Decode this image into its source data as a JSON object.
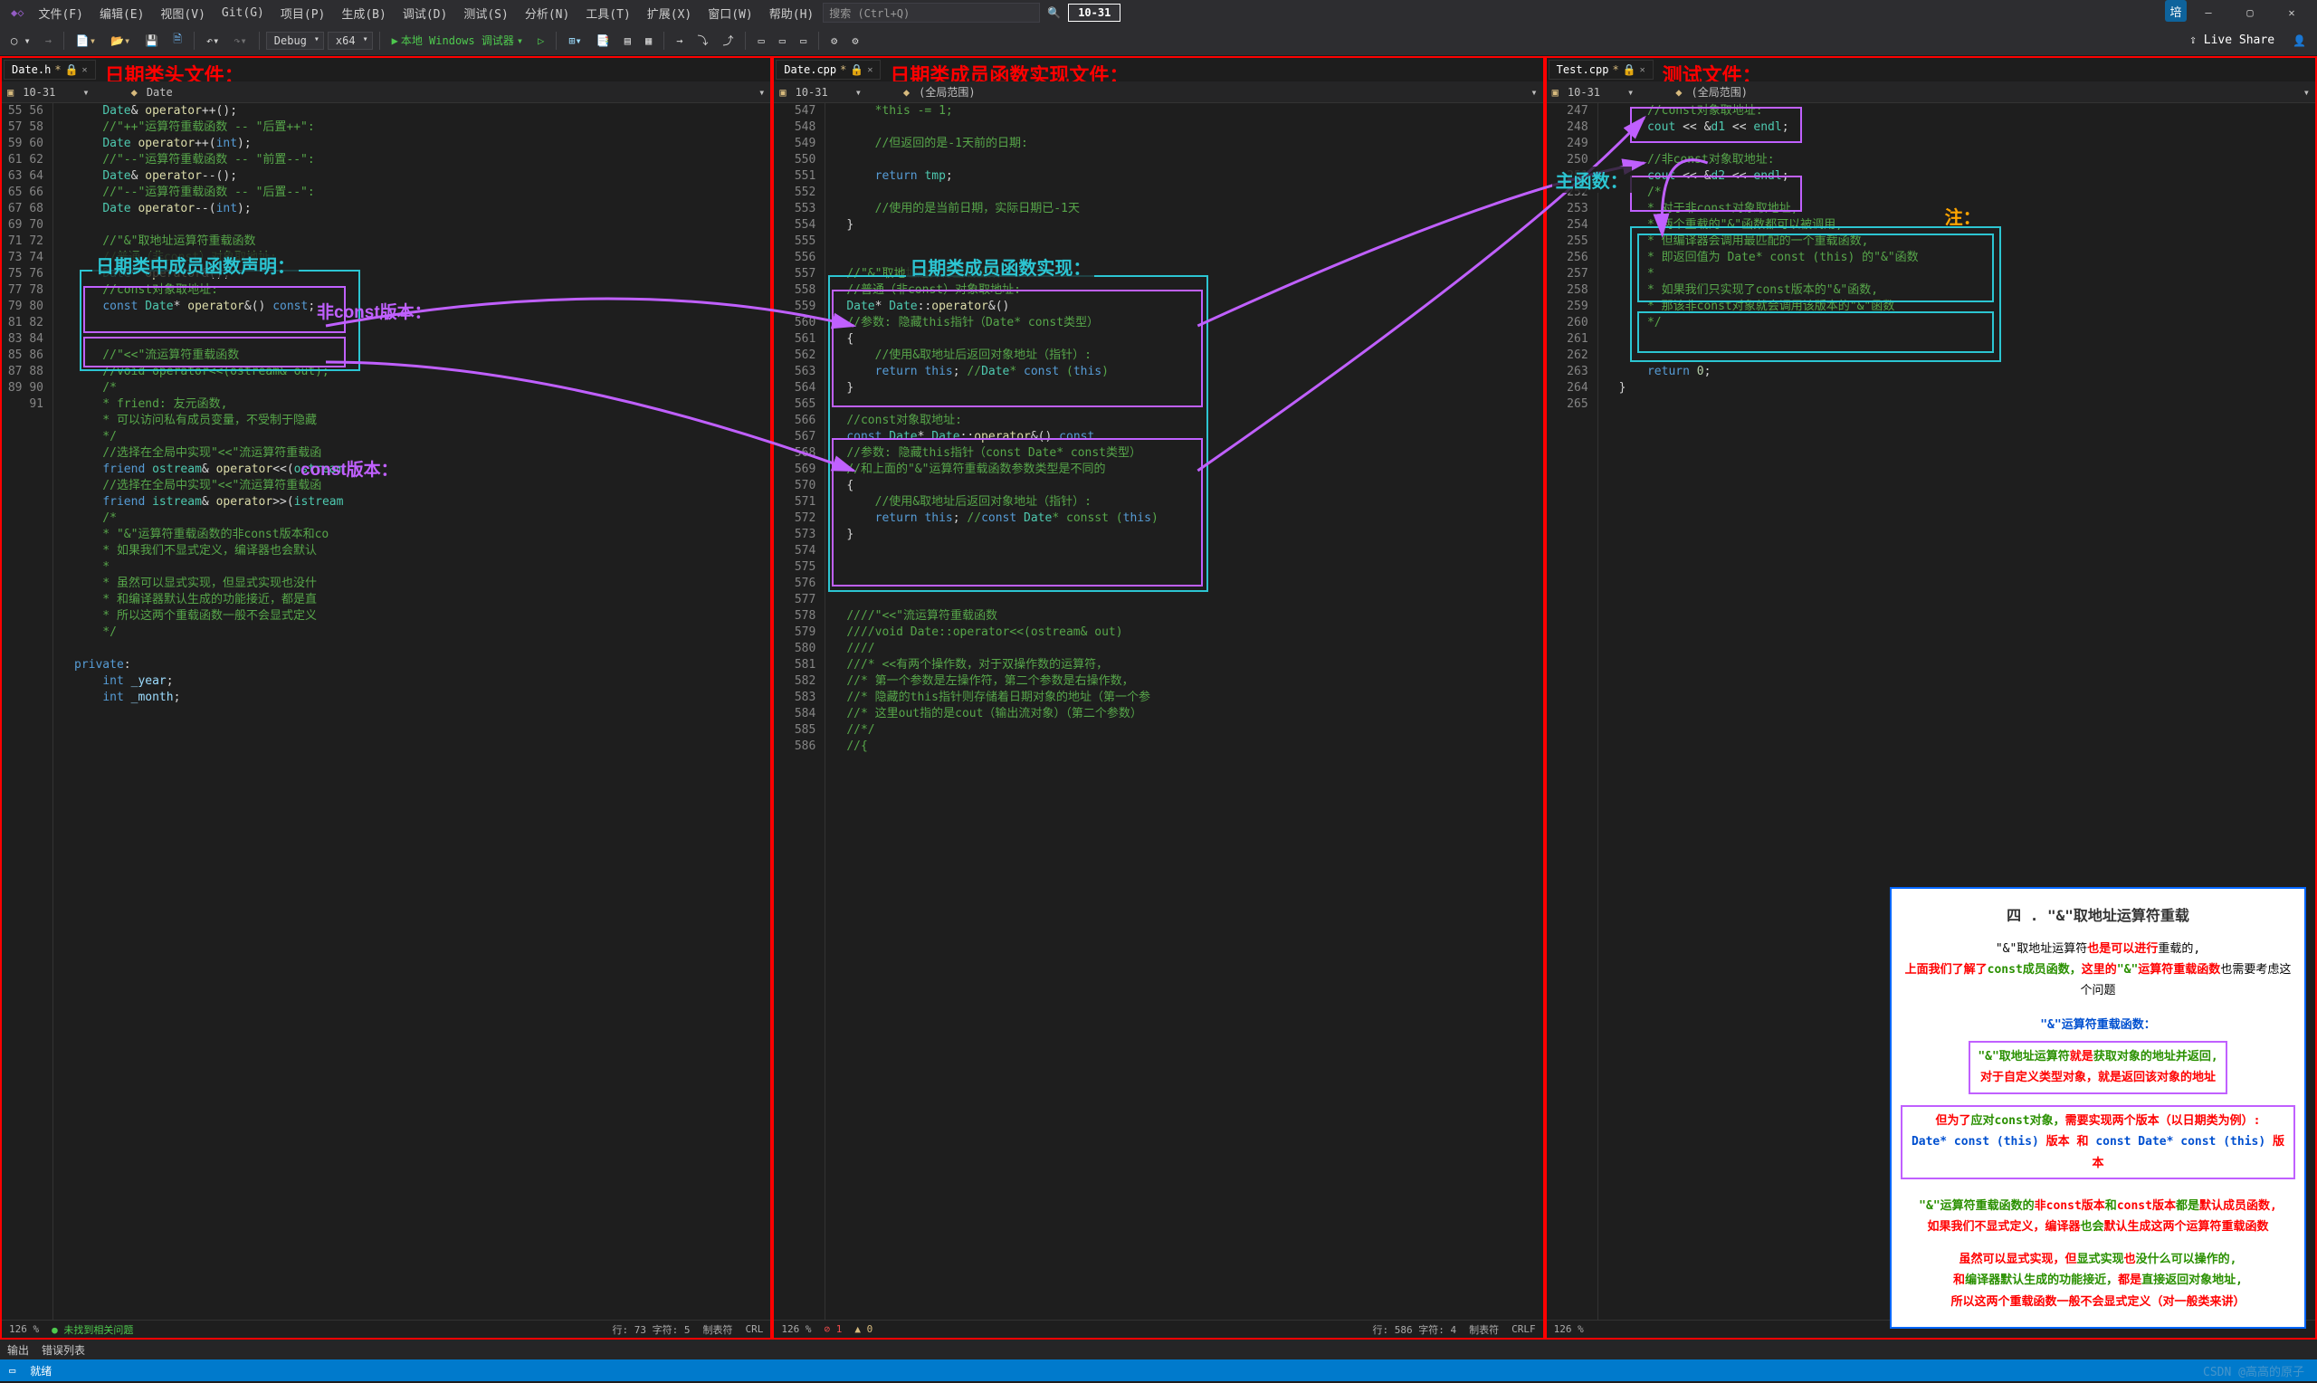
{
  "menu": [
    "文件(F)",
    "编辑(E)",
    "视图(V)",
    "Git(G)",
    "项目(P)",
    "生成(B)",
    "调试(D)",
    "测试(S)",
    "分析(N)",
    "工具(T)",
    "扩展(X)",
    "窗口(W)",
    "帮助(H)"
  ],
  "search_placeholder": "搜索 (Ctrl+Q)",
  "date_badge": "10-31",
  "user_initial": "培",
  "toolbar": {
    "config": "Debug",
    "platform": "x64",
    "debugger": "本地 Windows 调试器",
    "live_share": "Live Share"
  },
  "panes": [
    {
      "tab": "Date.h*",
      "title_label": "日期类头文件：",
      "crumb_left": "10-31",
      "crumb_right": "Date",
      "status": {
        "zoom": "126 %",
        "issues": "未找到相关问题",
        "pos": "行: 73   字符: 5",
        "insert": "制表符",
        "eol": "CRL"
      },
      "first_line": 55,
      "lines": [
        "    Date& operator++();",
        "    //\"++\"运算符重载函数 -- \"后置++\":",
        "    Date operator++(int);",
        "    //\"--\"运算符重载函数 -- \"前置--\":",
        "    Date& operator--();",
        "    //\"--\"运算符重载函数 -- \"后置--\":",
        "    Date operator--(int);",
        "",
        "    //\"&\"取地址运算符重载函数",
        "    //普通（非const）对象取地址:",
        "    Date* operator&();",
        "    //const对象取地址:",
        "    const Date* operator&() const;",
        "",
        "",
        "    //\"<<\"流运算符重载函数",
        "    //void operator<<(ostream& out);",
        "    /*",
        "    * friend: 友元函数,",
        "    * 可以访问私有成员变量，不受制于隐藏",
        "    */",
        "    //选择在全局中实现\"<<\"流运算符重载函",
        "    friend ostream& operator<<(ostream",
        "    //选择在全局中实现\"<<\"流运算符重载函",
        "    friend istream& operator>>(istream",
        "    /*",
        "    * \"&\"运算符重载函数的非const版本和co",
        "    * 如果我们不显式定义，编译器也会默认",
        "    *",
        "    * 虽然可以显式实现，但显式实现也没什",
        "    * 和编译器默认生成的功能接近，都是直",
        "    * 所以这两个重载函数一般不会显式定义",
        "    */",
        "",
        "private:",
        "    int _year;",
        "    int _month;"
      ]
    },
    {
      "tab": "Date.cpp*",
      "title_label": "日期类成员函数实现文件：",
      "crumb_left": "10-31",
      "crumb_right": "(全局范围)",
      "status": {
        "zoom": "126 %",
        "err": "1",
        "warn": "0",
        "pos": "行: 586   字符: 4",
        "insert": "制表符",
        "eol": "CRLF"
      },
      "first_line": 547,
      "lines": [
        "    *this -= 1;",
        "",
        "    //但返回的是-1天前的日期:",
        "",
        "    return tmp;",
        "",
        "    //使用的是当前日期，实际日期已-1天",
        "}",
        "",
        "",
        "//\"&\"取地址运算符重载函数:",
        "//普通（非const）对象取地址:",
        "Date* Date::operator&()",
        "//参数: 隐藏this指针（Date* const类型）",
        "{",
        "    //使用&取地址后返回对象地址（指针）:",
        "    return this; //Date* const (this)",
        "}",
        "",
        "//const对象取地址:",
        "const Date* Date::operator&() const",
        "//参数: 隐藏this指针（const Date* const类型）",
        "//和上面的\"&\"运算符重载函数参数类型是不同的",
        "{",
        "    //使用&取地址后返回对象地址（指针）:",
        "    return this; //const Date* consst (this)",
        "}",
        "",
        "",
        "",
        "",
        "////\"<<\"流运算符重载函数",
        "////void Date::operator<<(ostream& out)",
        "////",
        "///* <<有两个操作数，对于双操作数的运算符，",
        "//* 第一个参数是左操作符，第二个参数是右操作数，",
        "//* 隐藏的this指针则存储着日期对象的地址（第一个参",
        "//* 这里out指的是cout（输出流对象）（第二个参数）",
        "//*/",
        "//{"
      ]
    },
    {
      "tab": "Test.cpp*",
      "title_label": "测试文件：",
      "crumb_left": "10-31",
      "crumb_right": "(全局范围)",
      "status": {
        "zoom": "126 %"
      },
      "first_line": 247,
      "lines": [
        "    //const对象取地址:",
        "    cout << &d1 << endl;",
        "",
        "    //非const对象取地址:",
        "    cout << &d2 << endl;",
        "    /*",
        "    * 对于非const对象取地址,",
        "    * 两个重载的\"&\"函数都可以被调用,",
        "    * 但编译器会调用最匹配的一个重载函数,",
        "    * 即返回值为 Date* const (this) 的\"&\"函数",
        "    *",
        "    * 如果我们只实现了const版本的\"&\"函数,",
        "    * 那该非const对象就会调用该版本的\"&\"函数",
        "    */",
        "",
        "",
        "    return 0;",
        "}",
        ""
      ]
    }
  ],
  "labels": {
    "member_decl": "日期类中成员函数声明：",
    "nonconst_ver": "非const版本：",
    "const_ver": "const版本：",
    "impl_label": "日期类成员函数实现：",
    "main_fn": "主函数：",
    "note_label": "注："
  },
  "note": {
    "title": "四 . \"&\"取地址运算符重载",
    "l1a": "\"&\"取地址运算符",
    "l1b": "也是可以进行",
    "l1c": "重载的,",
    "l2a": "上面我们了解了",
    "l2b": "const成员函数，",
    "l2c": "这里的",
    "l2d": "\"&\"",
    "l2e": "运算符重载函数",
    "l2f": "也需要考虑这个问题",
    "h2": "\"&\"运算符重载函数：",
    "b1a": "\"&\"取地址运算符",
    "b1b": "就是",
    "b1c": "获取对象的地址并返回,",
    "b1d": "对于自定义类型对象，就是返回该对象的地址",
    "b2a": "但为了",
    "b2b": "应对const对象，",
    "b2c": "需要实现两个版本（以日期类为例）:",
    "b2d": "Date* const (this)",
    "b2e": " 版本 ",
    "b2f": "和 ",
    "b2g": "const Date* const (this)",
    "b2h": " 版本",
    "l3a": "\"&\"运算符重载函数的",
    "l3b": "非const版本",
    "l3c": "和",
    "l3d": "const版本",
    "l3e": "都是",
    "l3f": "默认成员函数,",
    "l4a": "如果我们不显式定义，编译器",
    "l4b": "也会",
    "l4c": "默认生成这两个运算符重载函数",
    "l5a": "虽然可以显式实现，但",
    "l5b": "显式实现",
    "l5c": "也",
    "l5d": "没什么可以操作的,",
    "l6a": "和",
    "l6b": "编译器默认生成的功能接近，",
    "l6c": "都是",
    "l6d": "直接返回对象地址,",
    "l7": "所以这两个重载函数一般不会显式定义（对一般类来讲）"
  },
  "status": {
    "output": "输出",
    "errlist": "错误列表",
    "ready": "就绪"
  },
  "watermark": "CSDN @高高的原子"
}
